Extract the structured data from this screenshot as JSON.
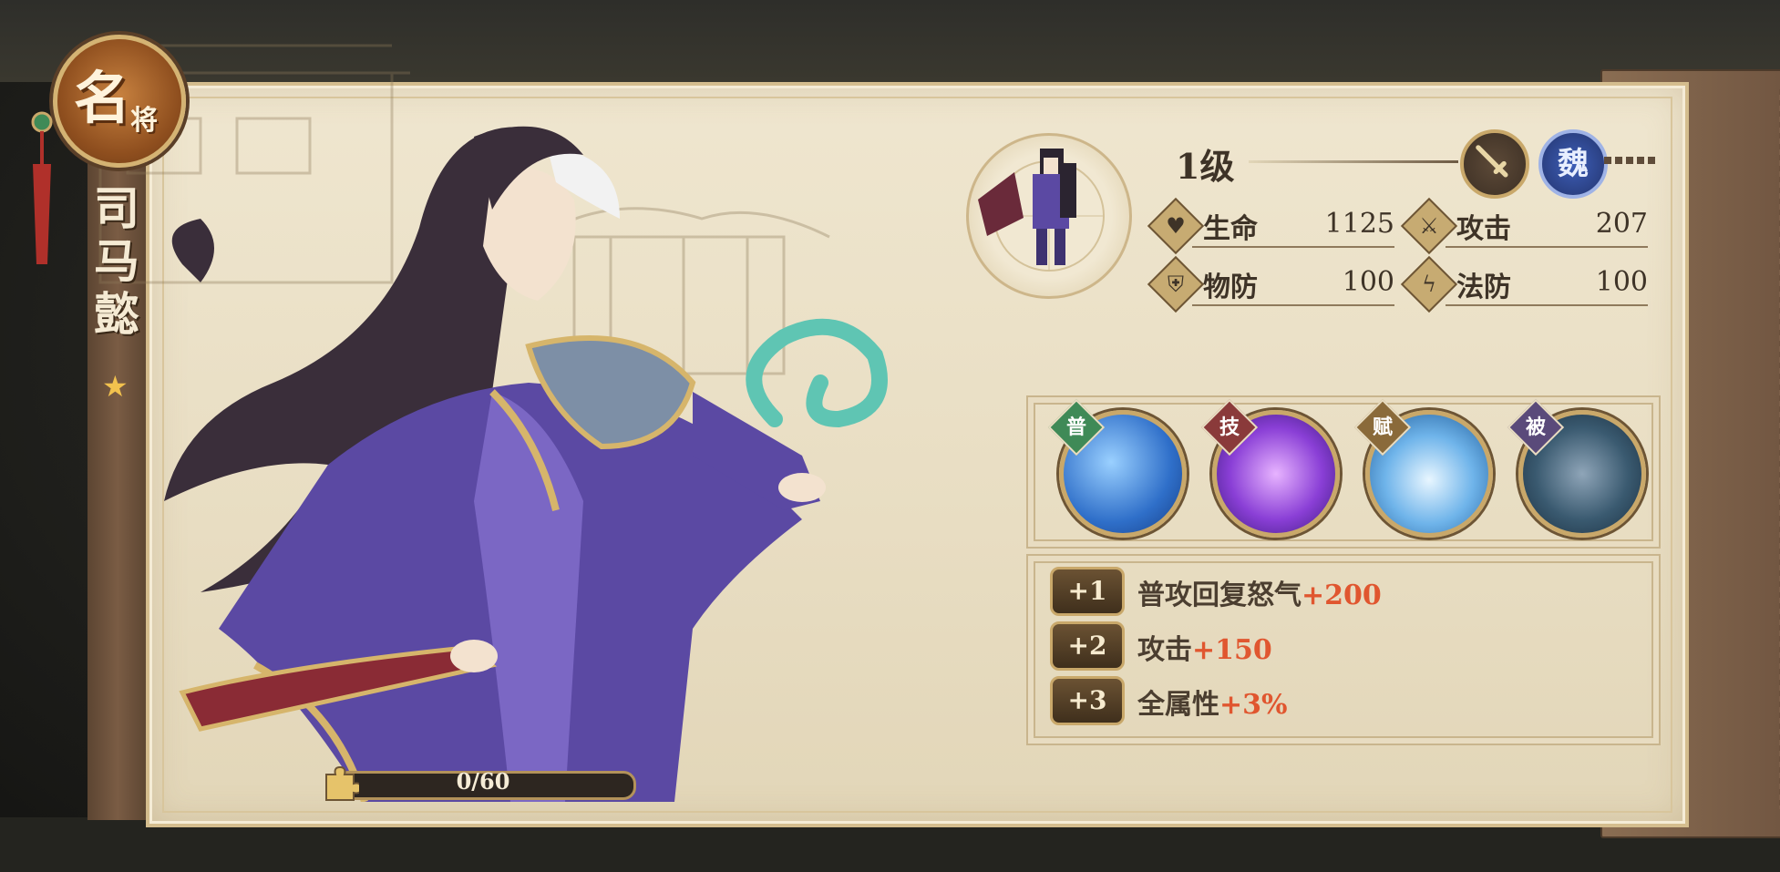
{
  "card": {
    "badge_main": "名",
    "badge_sub": "将",
    "hero_name_chars": [
      "司",
      "马",
      "懿"
    ],
    "star": "★"
  },
  "shards": {
    "progress_text": "0/60",
    "fraction": 0
  },
  "info": {
    "level": "1级",
    "faction": "魏",
    "weapon_icon": "sword-icon",
    "stats": [
      {
        "label": "生命",
        "value": "1125",
        "icon": "heart-icon"
      },
      {
        "label": "攻击",
        "value": "207",
        "icon": "sword-icon"
      },
      {
        "label": "物防",
        "value": "100",
        "icon": "shield-icon"
      },
      {
        "label": "法防",
        "value": "100",
        "icon": "lightning-icon"
      }
    ]
  },
  "skills": [
    {
      "tag": "普",
      "tag_color": "#3f8a57"
    },
    {
      "tag": "技",
      "tag_color": "#8a3a3a"
    },
    {
      "tag": "赋",
      "tag_color": "#8a6a3a"
    },
    {
      "tag": "被",
      "tag_color": "#5a4a7a"
    }
  ],
  "bonuses": [
    {
      "badge": "+1",
      "text": "普攻回复怒气",
      "value": "+200"
    },
    {
      "badge": "+2",
      "text": "攻击",
      "value": "+150"
    },
    {
      "badge": "+3",
      "text": "全属性",
      "value": "+3%"
    }
  ]
}
